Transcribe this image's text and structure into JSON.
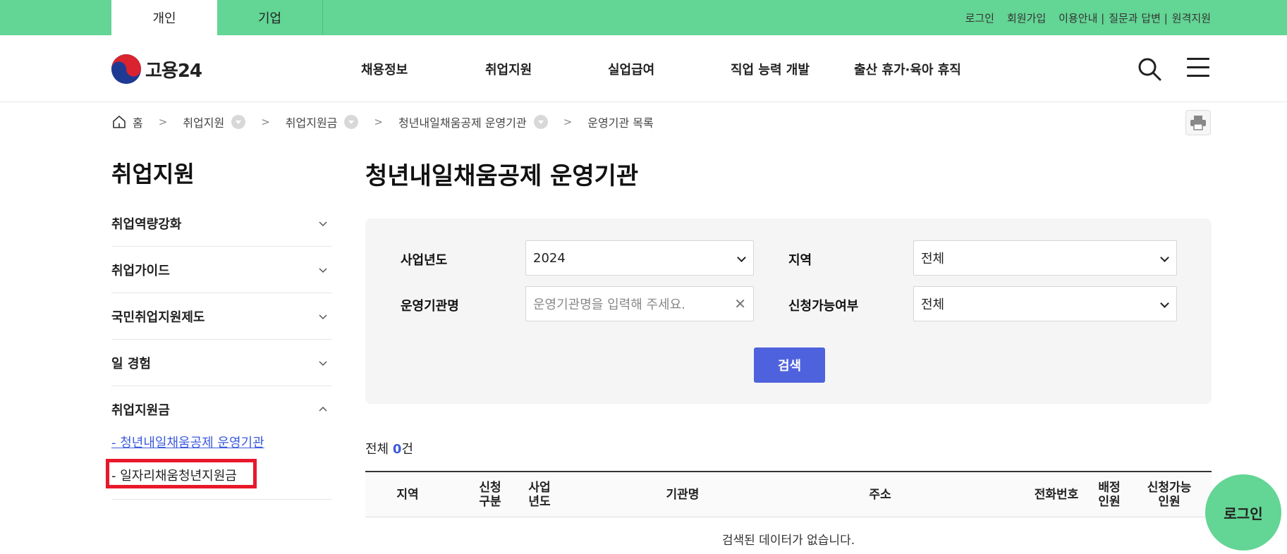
{
  "topbar": {
    "tabs": [
      "개인",
      "기업"
    ],
    "links": [
      "로그인",
      "회원가입",
      "이용안내 |",
      "질문과 답변 |",
      "원격지원"
    ]
  },
  "header": {
    "logo_text": "고용24",
    "nav": [
      "채용정보",
      "취업지원",
      "실업급여",
      "직업 능력 개발",
      "출산 휴가·육아 휴직"
    ]
  },
  "breadcrumb": {
    "items": [
      "홈",
      "취업지원",
      "취업지원금",
      "청년내일채움공제 운영기관",
      "운영기관 목록"
    ]
  },
  "sidebar": {
    "title": "취업지원",
    "items": [
      "취업역량강화",
      "취업가이드",
      "국민취업지원제도",
      "일 경험",
      "취업지원금"
    ],
    "subitems": [
      "- 청년내일채움공제 운영기관",
      "- 일자리채움청년지원금"
    ]
  },
  "main": {
    "title": "청년내일채움공제 운영기관",
    "filters": {
      "year_label": "사업년도",
      "year_value": "2024",
      "region_label": "지역",
      "region_value": "전체",
      "org_label": "운영기관명",
      "org_placeholder": "운영기관명을 입력해 주세요.",
      "avail_label": "신청가능여부",
      "avail_value": "전체"
    },
    "search_button": "검색",
    "total_prefix": "전체 ",
    "total_count": "0",
    "total_suffix": "건",
    "columns": [
      "지역",
      "신청 구분",
      "사업 년도",
      "기관명",
      "주소",
      "전화번호",
      "배정 인원",
      "신청가능 인원"
    ],
    "empty_message": "검색된 데이터가 없습니다."
  },
  "fab": {
    "label": "로그인"
  },
  "colors": {
    "brand_green": "#63d594",
    "accent_blue": "#4f62dd",
    "highlight_red": "#e8182a"
  }
}
